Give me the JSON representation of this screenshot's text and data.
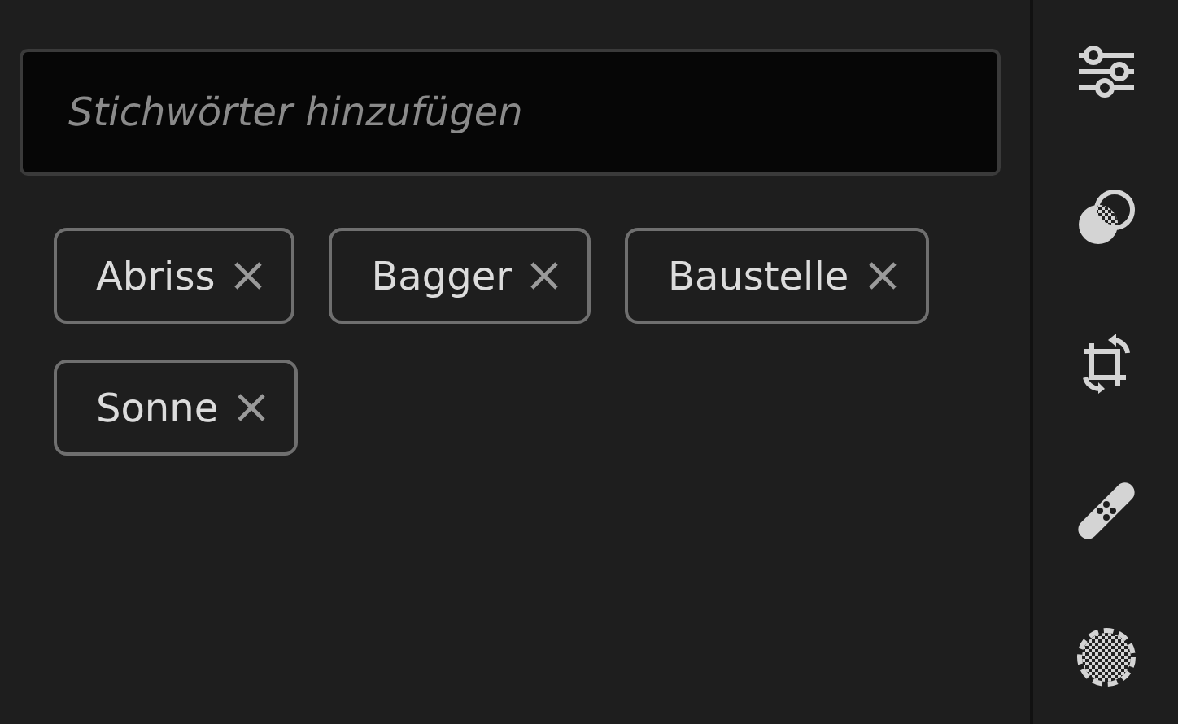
{
  "keyword_field": {
    "placeholder": "Stichwörter hinzufügen"
  },
  "tags": [
    {
      "label": "Abriss"
    },
    {
      "label": "Bagger"
    },
    {
      "label": "Baustelle"
    },
    {
      "label": "Sonne"
    }
  ],
  "toolbar": {
    "tools": [
      {
        "kind": "sliders"
      },
      {
        "kind": "color"
      },
      {
        "kind": "crop"
      },
      {
        "kind": "heal"
      },
      {
        "kind": "mask"
      }
    ]
  }
}
